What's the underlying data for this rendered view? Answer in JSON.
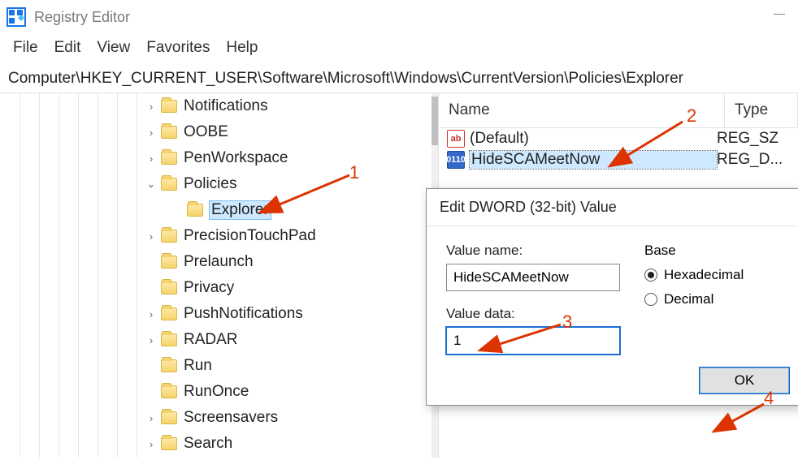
{
  "app": {
    "title": "Registry Editor"
  },
  "menu": {
    "items": [
      "File",
      "Edit",
      "View",
      "Favorites",
      "Help"
    ]
  },
  "address": "Computer\\HKEY_CURRENT_USER\\Software\\Microsoft\\Windows\\CurrentVersion\\Policies\\Explorer",
  "tree": {
    "items": [
      {
        "label": "Notifications",
        "exp": "closed"
      },
      {
        "label": "OOBE",
        "exp": "closed"
      },
      {
        "label": "PenWorkspace",
        "exp": "closed"
      },
      {
        "label": "Policies",
        "exp": "open"
      },
      {
        "label": "Explorer",
        "exp": "none",
        "child": true,
        "selected": true
      },
      {
        "label": "PrecisionTouchPad",
        "exp": "closed"
      },
      {
        "label": "Prelaunch",
        "exp": "none"
      },
      {
        "label": "Privacy",
        "exp": "none"
      },
      {
        "label": "PushNotifications",
        "exp": "closed"
      },
      {
        "label": "RADAR",
        "exp": "closed"
      },
      {
        "label": "Run",
        "exp": "none"
      },
      {
        "label": "RunOnce",
        "exp": "none"
      },
      {
        "label": "Screensavers",
        "exp": "closed"
      },
      {
        "label": "Search",
        "exp": "closed"
      }
    ]
  },
  "list": {
    "columns": {
      "name": "Name",
      "type": "Type"
    },
    "rows": [
      {
        "icon": "ab",
        "name": "(Default)",
        "type": "REG_SZ",
        "selected": false
      },
      {
        "icon": "bin",
        "name": "HideSCAMeetNow",
        "type": "REG_D...",
        "selected": true
      }
    ]
  },
  "dialog": {
    "title": "Edit DWORD (32-bit) Value",
    "value_name_label": "Value name:",
    "value_name": "HideSCAMeetNow",
    "value_data_label": "Value data:",
    "value_data": "1",
    "base_label": "Base",
    "radio_hex": "Hexadecimal",
    "radio_dec": "Decimal",
    "ok": "OK"
  },
  "annotations": {
    "a1": "1",
    "a2": "2",
    "a3": "3",
    "a4": "4"
  }
}
